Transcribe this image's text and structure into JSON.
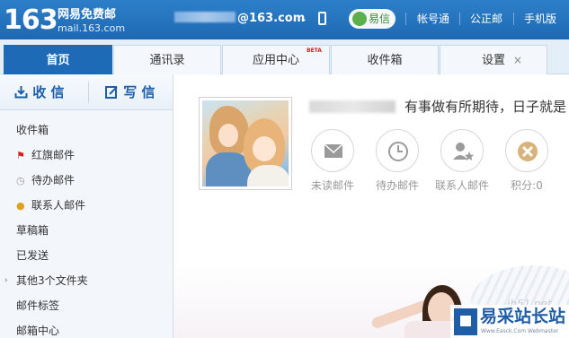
{
  "header": {
    "logo_number": "163",
    "logo_title": "网易免费邮",
    "logo_url": "mail.163.com",
    "user_email_suffix": "@163.com",
    "chevron": "⌄",
    "yixin_label": "易信",
    "links": [
      "帐号通",
      "公正邮",
      "手机版"
    ]
  },
  "tabs": [
    {
      "label": "首页",
      "active": true
    },
    {
      "label": "通讯录",
      "active": false
    },
    {
      "label": "应用中心",
      "active": false,
      "badge": "BETA"
    },
    {
      "label": "收件箱",
      "active": false
    },
    {
      "label": "设置",
      "active": false,
      "close": "×"
    }
  ],
  "sidebar": {
    "receive_label": "收 信",
    "write_label": "写 信",
    "folders": [
      {
        "label": "收件箱",
        "icon": ""
      },
      {
        "label": "红旗邮件",
        "icon": "red-flag-icon"
      },
      {
        "label": "待办邮件",
        "icon": "clock-icon"
      },
      {
        "label": "联系人邮件",
        "icon": "contact-icon"
      },
      {
        "label": "草稿箱",
        "icon": ""
      },
      {
        "label": "已发送",
        "icon": ""
      },
      {
        "label": "其他3个文件夹",
        "icon": "caret-right-icon"
      },
      {
        "label": "邮件标签",
        "icon": ""
      },
      {
        "label": "邮箱中心",
        "icon": ""
      }
    ]
  },
  "main": {
    "motto": "有事做有所期待，日子就是",
    "shortcuts": [
      {
        "label": "未读邮件",
        "icon": "envelope-icon"
      },
      {
        "label": "待办邮件",
        "icon": "clock-icon"
      },
      {
        "label": "联系人邮件",
        "icon": "contact-star-icon"
      },
      {
        "label": "积分:0",
        "icon": "points-icon"
      }
    ]
  },
  "watermark": {
    "faint": "jb51.net",
    "title": "易采站长站",
    "url": "Www.Easck.Com  Webmaster"
  },
  "colors": {
    "brand_blue": "#1e68b3",
    "tab_active": "#1e6ab7",
    "flag_red": "#d02020"
  }
}
